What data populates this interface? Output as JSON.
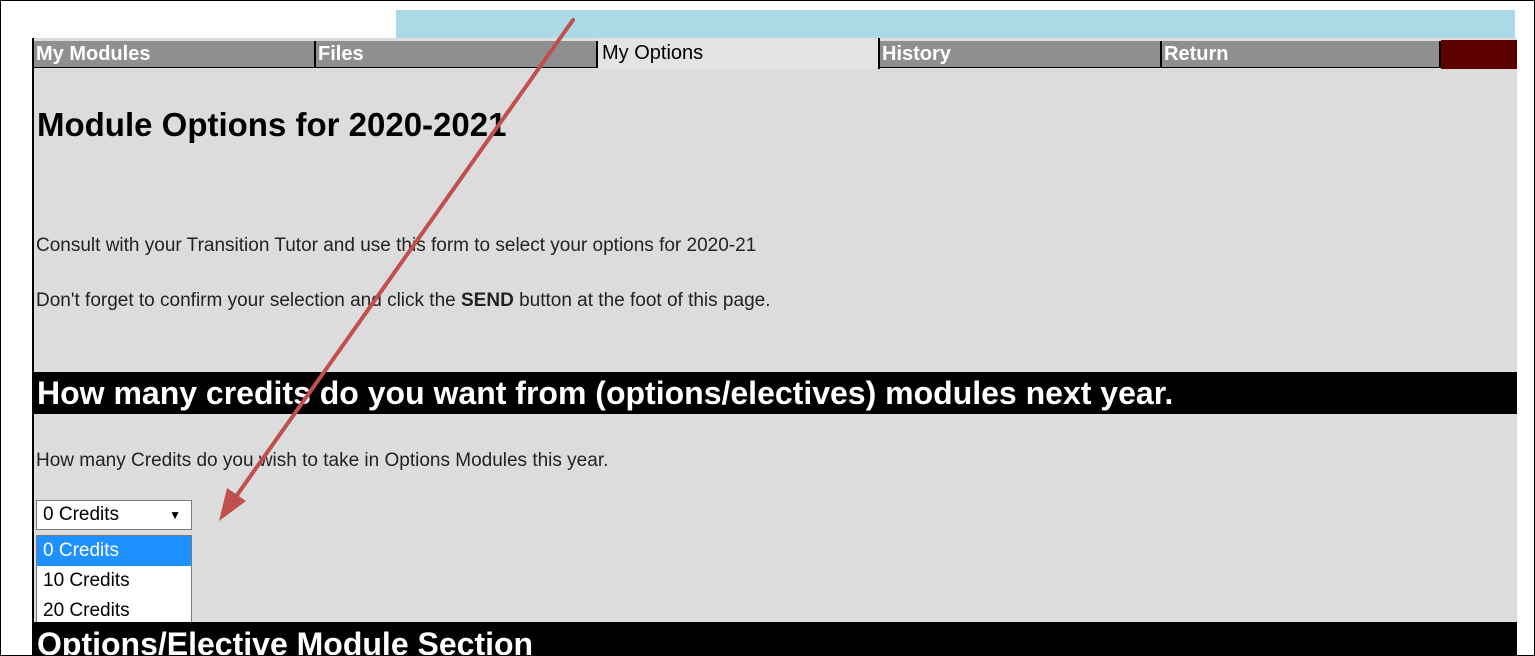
{
  "tabs": [
    {
      "label": "My Modules",
      "active": false
    },
    {
      "label": "Files",
      "active": false
    },
    {
      "label": "My Options",
      "active": true
    },
    {
      "label": "History",
      "active": false
    },
    {
      "label": "Return",
      "active": false
    }
  ],
  "main": {
    "title": "Module Options for 2020-2021",
    "intro": "Consult with your Transition Tutor and use this form to select your options for 2020-21",
    "reminder_before": "Don't forget to confirm your selection and click the ",
    "reminder_bold": "SEND",
    "reminder_after": " button at the foot of this page.",
    "credits_heading": "How many credits do you want from (options/electives) modules next year.",
    "credits_question": "How many Credits do you wish to take in Options Modules this year.",
    "credits_select": {
      "selected": "0 Credits",
      "options": [
        "0 Credits",
        "10 Credits",
        "20 Credits"
      ]
    },
    "options_heading": "Options/Elective Module Section"
  },
  "colors": {
    "tab_inactive": "#8f8f8f",
    "tab_active": "#e3e3e3",
    "tab_end": "#5c0000",
    "top_strip": "#add8e6",
    "content_bg": "#dcdcdc",
    "annotation_arrow": "#c0504d",
    "option_highlight": "#1e90ff"
  }
}
